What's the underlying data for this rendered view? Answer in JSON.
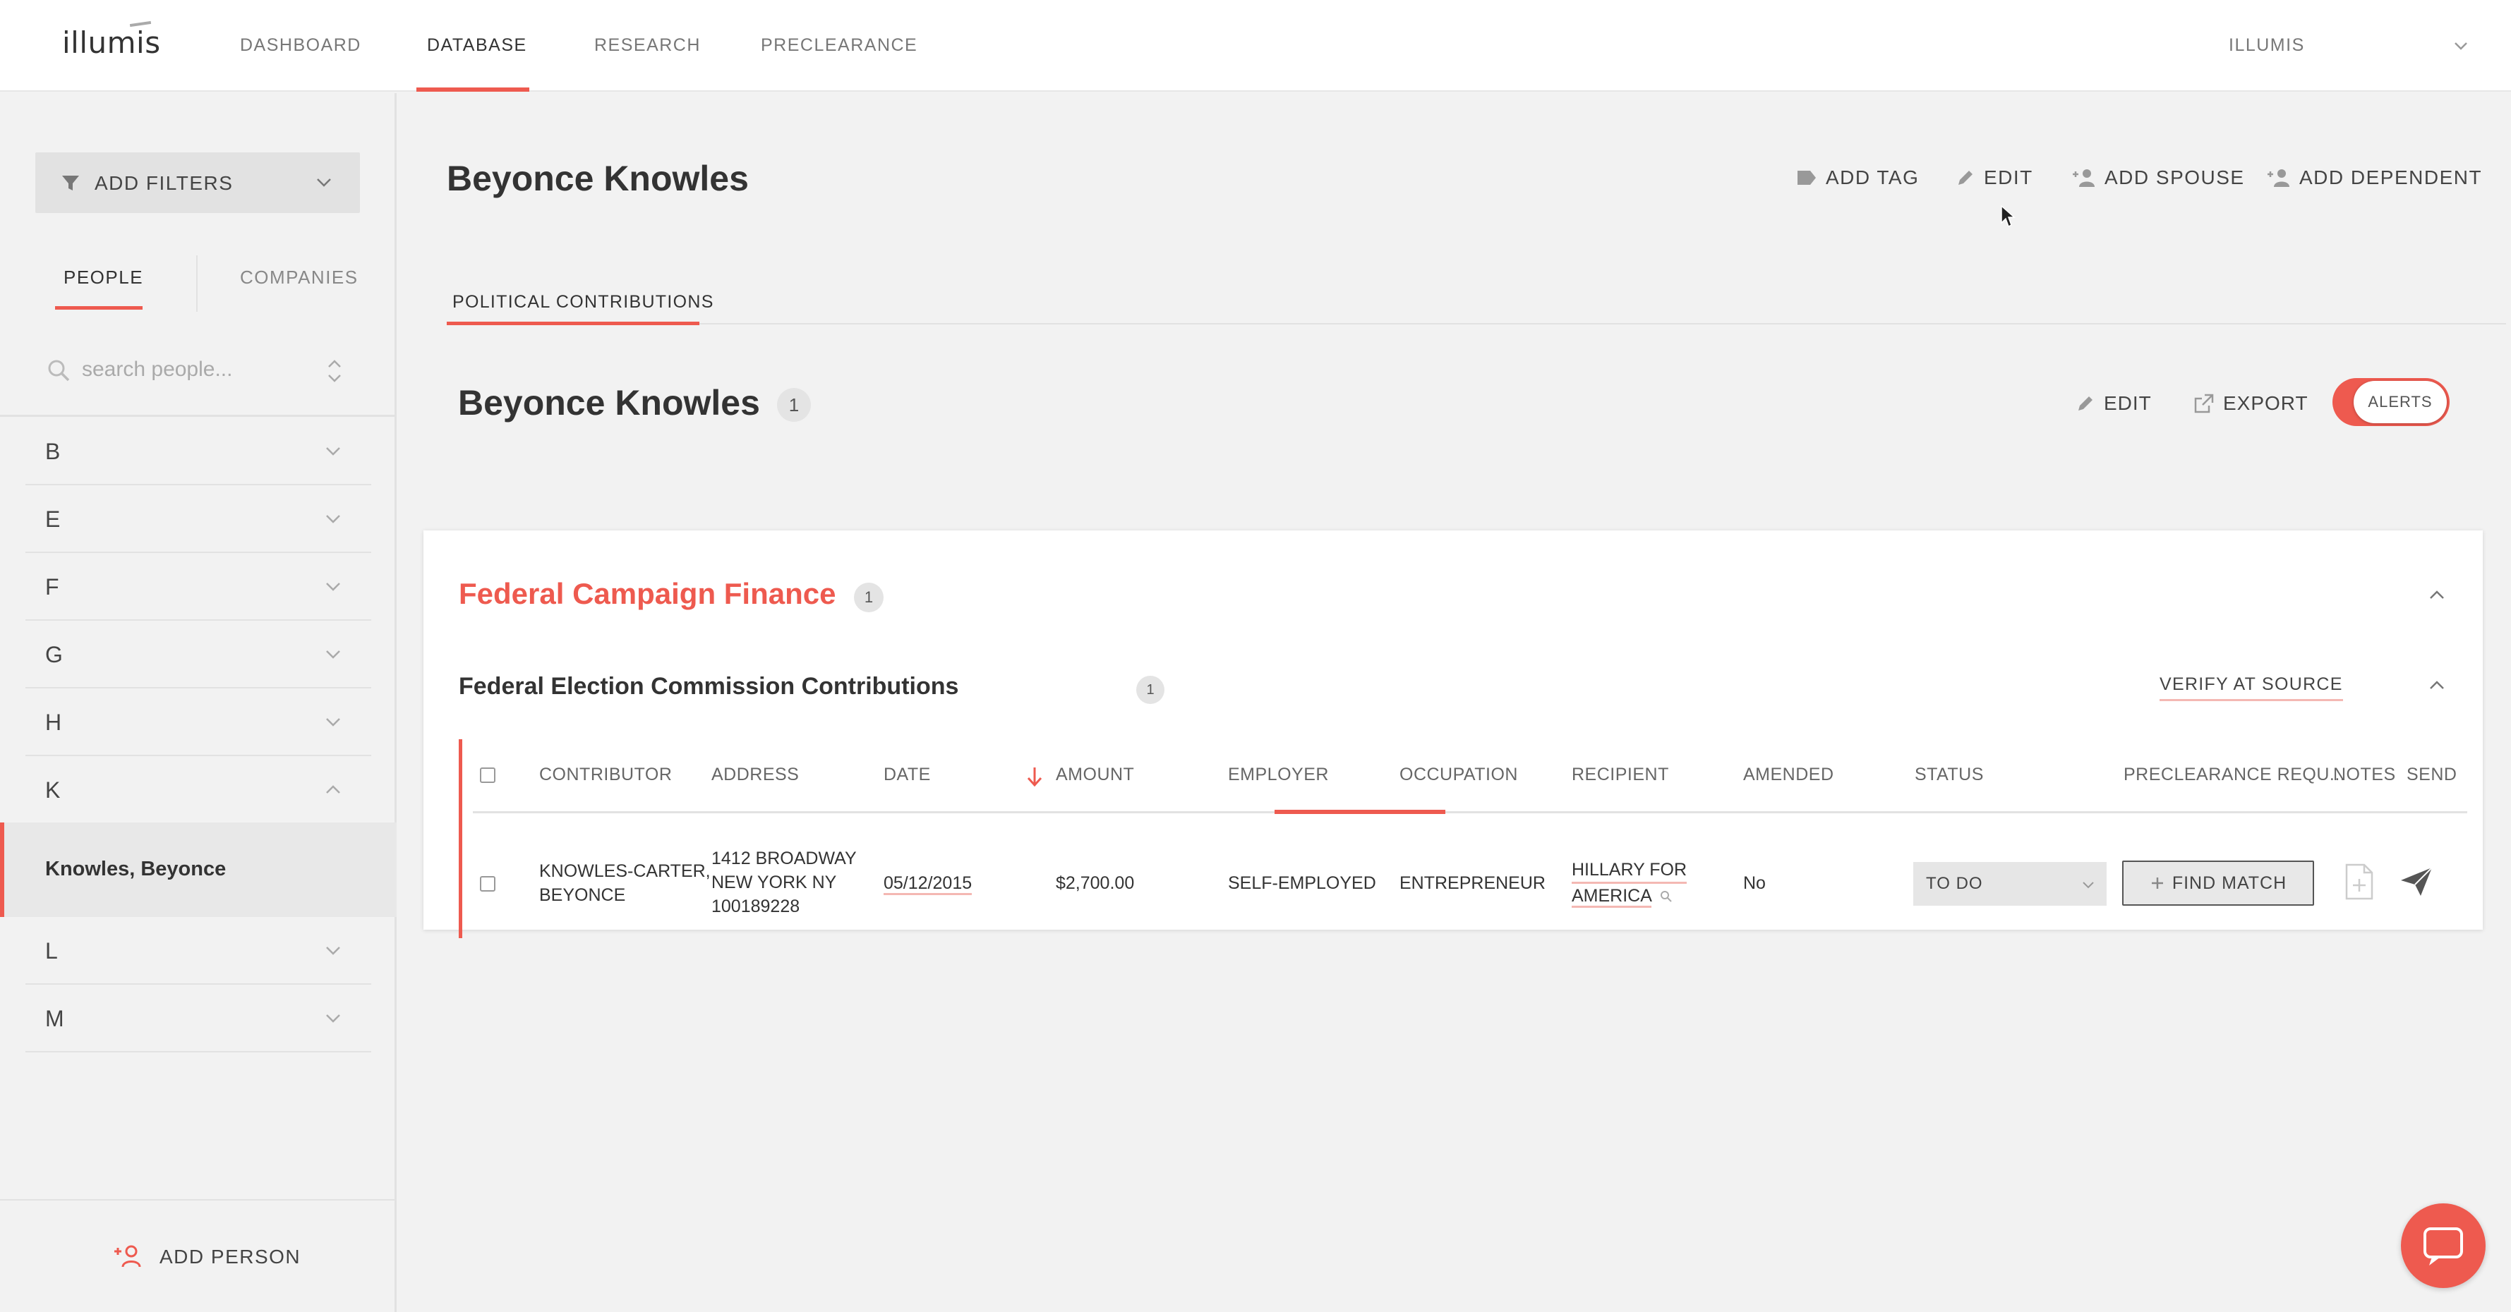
{
  "app": {
    "logo": "illumis",
    "nav": [
      "DASHBOARD",
      "DATABASE",
      "RESEARCH",
      "PRECLEARANCE"
    ],
    "active_nav": "DATABASE",
    "org_name": "ILLUMIS"
  },
  "sidebar": {
    "filters_label": "ADD FILTERS",
    "tabs": {
      "people": "PEOPLE",
      "companies": "COMPANIES"
    },
    "active_tab": "PEOPLE",
    "search_placeholder": "search people...",
    "letters": [
      "B",
      "E",
      "F",
      "G",
      "H",
      "K",
      "L",
      "M"
    ],
    "expanded_letter": "K",
    "selected_person": "Knowles, Beyonce",
    "add_person_label": "ADD PERSON"
  },
  "header": {
    "title": "Beyonce Knowles",
    "actions": {
      "add_tag": "ADD TAG",
      "edit": "EDIT",
      "add_spouse": "ADD SPOUSE",
      "add_dependent": "ADD DEPENDENT"
    }
  },
  "tabs": {
    "political_contributions": "POLITICAL CONTRIBUTIONS"
  },
  "section": {
    "title": "Beyonce Knowles",
    "count": "1",
    "edit": "EDIT",
    "export": "EXPORT",
    "alerts_label": "ALERTS",
    "alerts_on": true
  },
  "card": {
    "title": "Federal Campaign Finance",
    "count": "1",
    "subsection": {
      "title": "Federal Election Commission Contributions",
      "count": "1",
      "verify_label": "VERIFY AT SOURCE"
    },
    "table": {
      "headers": {
        "contributor": "CONTRIBUTOR",
        "address": "ADDRESS",
        "date": "DATE",
        "amount": "AMOUNT",
        "employer": "EMPLOYER",
        "occupation": "OCCUPATION",
        "recipient": "RECIPIENT",
        "amended": "AMENDED",
        "status": "STATUS",
        "preclearance": "PRECLEARANCE REQU...",
        "notes": "NOTES",
        "send": "SEND"
      },
      "sorted_by": "AMOUNT",
      "rows": [
        {
          "contributor_1": "KNOWLES-CARTER,",
          "contributor_2": "BEYONCE",
          "address_1": "1412 BROADWAY",
          "address_2": "NEW YORK NY",
          "address_3": "100189228",
          "date": "05/12/2015",
          "amount": "$2,700.00",
          "employer": "SELF-EMPLOYED",
          "occupation": "ENTREPRENEUR",
          "recipient_1": "HILLARY FOR",
          "recipient_2": "AMERICA",
          "amended": "No",
          "status": "TO DO",
          "find_match": "FIND MATCH"
        }
      ]
    }
  },
  "colors": {
    "accent": "#ee5a4f",
    "background": "#f2f2f2"
  },
  "icons": [
    "filter-icon",
    "chevron-down-icon",
    "search-icon",
    "sort-icon",
    "add-person-icon",
    "tag-icon",
    "pencil-icon",
    "add-user-icon",
    "export-icon",
    "chevron-up-icon",
    "arrow-down-icon",
    "magnify-icon",
    "plus-icon",
    "file-icon",
    "send-icon",
    "chat-icon",
    "cursor-icon"
  ]
}
